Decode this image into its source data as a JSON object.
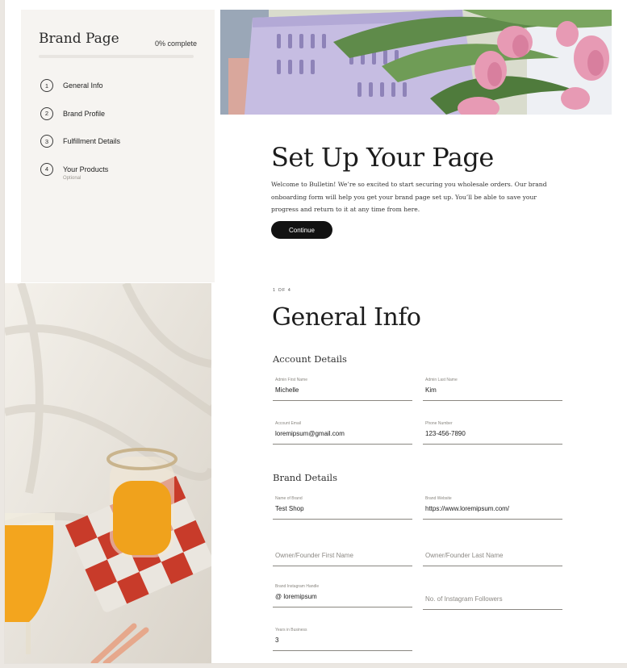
{
  "sidebar": {
    "title": "Brand Page",
    "progress_label": "0% complete",
    "progress": 0,
    "steps": [
      {
        "number": "1",
        "label": "General Info"
      },
      {
        "number": "2",
        "label": "Brand Profile"
      },
      {
        "number": "3",
        "label": "Fulfillment Details"
      },
      {
        "number": "4",
        "label": "Your Products",
        "sub": "Optional"
      }
    ]
  },
  "intro": {
    "title": "Set Up Your Page",
    "text": "Welcome to Bulletin! We’re so excited to start securing you wholesale orders. Our brand onboarding form will help you get your brand page set up. You’ll be able to save your progress and return to it at any time from here.",
    "continue_label": "Continue"
  },
  "form": {
    "step_indicator": "1 OF 4",
    "title": "General Info",
    "account_heading": "Account Details",
    "account_fields": [
      {
        "label": "Admin First Name",
        "value": "Michelle"
      },
      {
        "label": "Admin Last Name",
        "value": "Kim"
      },
      {
        "label": "Account Email",
        "value": "loremipsum@gmail.com"
      },
      {
        "label": "Phone Number",
        "value": "123-456-7890"
      }
    ],
    "brand_heading": "Brand Details",
    "brand_fields": [
      {
        "label": "Name of Brand",
        "value": "Test Shop"
      },
      {
        "label": "Brand Website",
        "value": "https://www.loremipsum.com/"
      },
      {
        "placeholder": "Owner/Founder First Name"
      },
      {
        "placeholder": "Owner/Founder Last Name"
      },
      {
        "label": "Brand Instagram Handle",
        "value": "@  loremipsum"
      },
      {
        "placeholder": "No. of Instagram Followers"
      },
      {
        "label": "Years in Business",
        "value": "3"
      }
    ]
  },
  "colors": {
    "button": "#121212",
    "sidebar_bg": "#f6f4f1",
    "field_line": "#8a8781"
  }
}
